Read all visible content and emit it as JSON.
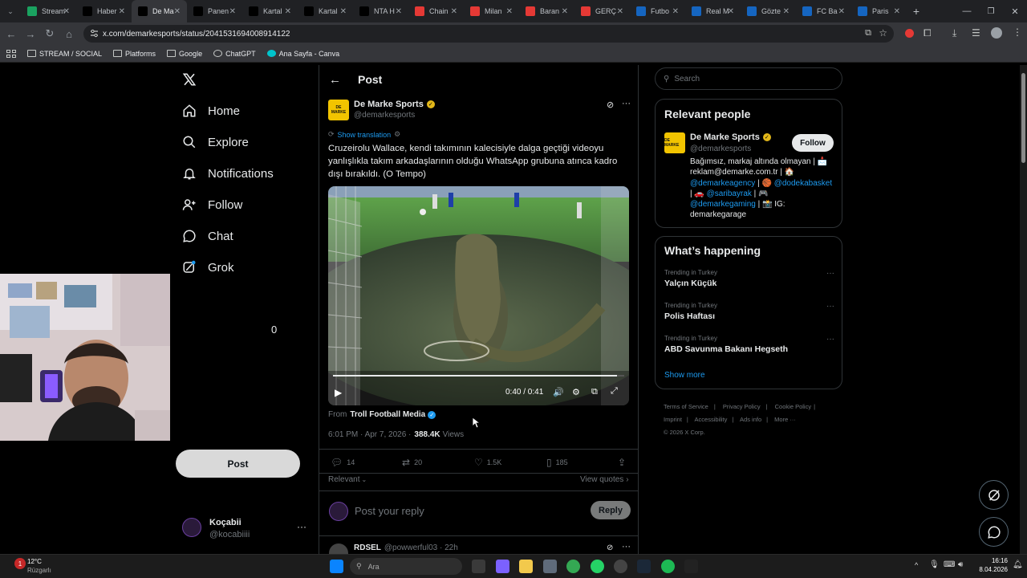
{
  "browser": {
    "tabs": [
      {
        "title": "Stream",
        "color": "#1aa260"
      },
      {
        "title": "Haber",
        "color": "#000000"
      },
      {
        "title": "De Ma",
        "color": "#000000"
      },
      {
        "title": "Panen",
        "color": "#000000"
      },
      {
        "title": "Kartal",
        "color": "#000000"
      },
      {
        "title": "Kartal",
        "color": "#000000"
      },
      {
        "title": "NTA H",
        "color": "#000000"
      },
      {
        "title": "Chain",
        "color": "#e53935"
      },
      {
        "title": "Milan",
        "color": "#e53935"
      },
      {
        "title": "Baran",
        "color": "#e53935"
      },
      {
        "title": "GERÇ",
        "color": "#e53935"
      },
      {
        "title": "Futbo",
        "color": "#1565c0"
      },
      {
        "title": "Real M",
        "color": "#1565c0"
      },
      {
        "title": "Gözte",
        "color": "#1565c0"
      },
      {
        "title": "FC Ba",
        "color": "#1565c0"
      },
      {
        "title": "Paris",
        "color": "#1565c0"
      }
    ],
    "url": "x.com/demarkesports/status/2041531694008914122",
    "bookmarks": [
      "STREAM / SOCIAL",
      "Platforms",
      "Google",
      "ChatGPT",
      "Ana Sayfa - Canva"
    ]
  },
  "nav": {
    "items": [
      "Home",
      "Explore",
      "Notifications",
      "Follow",
      "Chat",
      "Grok"
    ],
    "post_button": "Post",
    "user_name": "Koçabii",
    "user_handle": "@kocabiiii"
  },
  "overlay_digit": "0",
  "post": {
    "header": "Post",
    "author_name": "De Marke Sports",
    "author_handle": "@demarkesports",
    "avatar_text": "DE MARKE",
    "show_translation": "Show translation",
    "text": "Cruzeirolu Wallace, kendi takımının kalecisiyle dalga geçtiği videoyu yanlışlıkla takım arkadaşlarının olduğu WhatsApp grubuna atınca kadro dışı bırakıldı. (O Tempo)",
    "video_time": "0:40 / 0:41",
    "video_progress": 0.976,
    "from_label": "From",
    "from_account": "Troll Football Media",
    "timestamp": "6:01 PM · Apr 7, 2026 ·",
    "views_count": "388.4K",
    "views_label": "Views",
    "stats": {
      "replies": "14",
      "reposts": "20",
      "likes": "1.5K",
      "bookmarks": "185"
    },
    "sort_label": "Relevant",
    "view_quotes": "View quotes",
    "reply_placeholder": "Post your reply",
    "reply_button": "Reply",
    "next_reply_name": "RDSEL",
    "next_reply_handle": "@powwerful03 · 22h"
  },
  "sidebar": {
    "search_placeholder": "Search",
    "relevant_title": "Relevant people",
    "person_name": "De Marke Sports",
    "person_handle": "@demarkesports",
    "follow_label": "Follow",
    "bio": {
      "line1": "Bağımsız, markaj altında olmayan | 📩",
      "line2": "reklam@demarke.com.tr | 🏠",
      "mention1": "@demarkeagency",
      "sep1": "| 🏀",
      "mention2": "@dodekabasket",
      "pre3": "| 🚗",
      "mention3": "@saribayrak",
      "post3": "| 🎮",
      "mention4": "@demarkegaming",
      "post4": "| 📸 IG:",
      "line6": "demarkegarage"
    },
    "happening_title": "What’s happening",
    "trends": [
      {
        "context": "Trending in Turkey",
        "name": "Yalçın Küçük"
      },
      {
        "context": "Trending in Turkey",
        "name": "Polis Haftası"
      },
      {
        "context": "Trending in Turkey",
        "name": "ABD Savunma Bakanı Hegseth"
      }
    ],
    "show_more": "Show more",
    "footer": {
      "terms": "Terms of Service",
      "privacy": "Privacy Policy",
      "cookie": "Cookie Policy",
      "imprint": "Imprint",
      "accessibility": "Accessibility",
      "ads": "Ads info",
      "more": "More ···",
      "copyright": "© 2026 X Corp."
    }
  },
  "taskbar": {
    "temperature": "12°C",
    "weather": "Rüzgarlı",
    "search": "Ara",
    "time": "16:16",
    "date": "8.04.2026"
  }
}
